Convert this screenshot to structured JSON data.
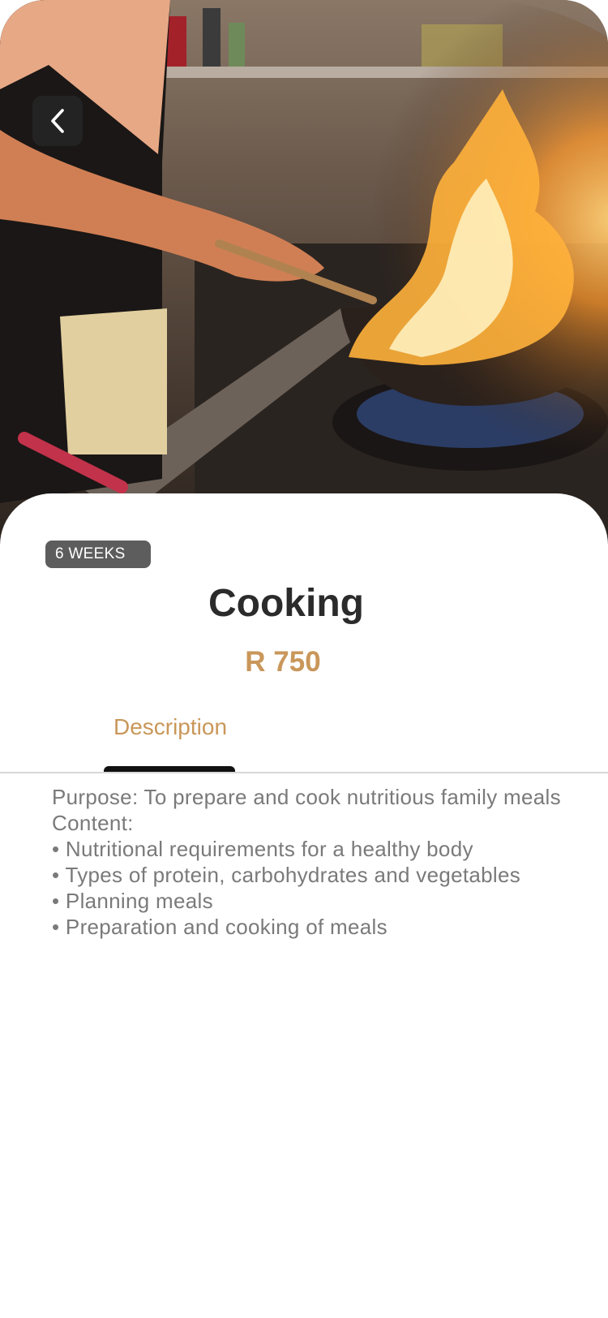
{
  "colors": {
    "accent": "#c9975a",
    "title": "#2b2b2b",
    "body_text": "#7a7a7a",
    "badge_bg": "#5d5d5d",
    "tab_indicator": "#111111"
  },
  "hero": {
    "image_icon": "photo-chef-flaming-wok",
    "back_icon": "chevron-left-icon"
  },
  "course": {
    "duration": "6 WEEKS",
    "title": "Cooking",
    "price": "R 750"
  },
  "tabs": [
    {
      "label": "Description",
      "active": true
    }
  ],
  "description": {
    "purpose": "Purpose: To prepare and cook nutritious family meals",
    "content_heading": "Content:",
    "items": [
      "• Nutritional requirements for a healthy body",
      "• Types of protein, carbohydrates and vegetables",
      "• Planning meals",
      "• Preparation and cooking of meals"
    ]
  }
}
